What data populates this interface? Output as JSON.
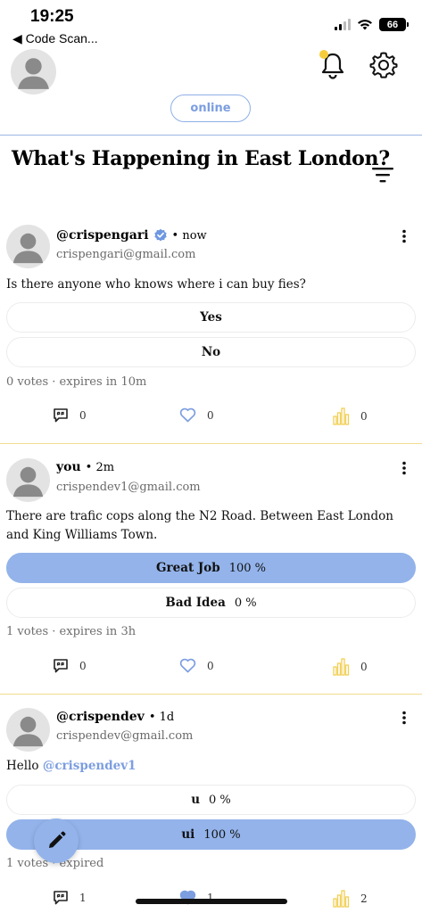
{
  "status_bar": {
    "time": "19:25",
    "back_app": "◀ Code Scan...",
    "battery": "66"
  },
  "header": {
    "online_label": "online",
    "accent_color": "#93b3ea",
    "notification_dot_color": "#f5cd3c"
  },
  "page": {
    "title": "What's Happening in East London?"
  },
  "posts": [
    {
      "username": "@crispengari",
      "verified": true,
      "time_ago": "• now",
      "email": "crispengari@gmail.com",
      "question": "Is there anyone who knows where i can buy fies?",
      "options": [
        {
          "label": "Yes",
          "percent": "",
          "selected": false
        },
        {
          "label": "No",
          "percent": "",
          "selected": false
        }
      ],
      "meta": "0 votes · expires in 10m",
      "comments": "0",
      "likes": "0",
      "stats": "0"
    },
    {
      "username": "you",
      "verified": false,
      "time_ago": "• 2m",
      "email": "crispendev1@gmail.com",
      "question": "There are trafic cops along the N2 Road. Between East London and King Williams Town.",
      "options": [
        {
          "label": "Great Job",
          "percent": "100 %",
          "selected": true
        },
        {
          "label": "Bad Idea",
          "percent": "0 %",
          "selected": false
        }
      ],
      "meta": "1 votes · expires in 3h",
      "comments": "0",
      "likes": "0",
      "stats": "0"
    },
    {
      "username": "@crispendev",
      "verified": false,
      "time_ago": "• 1d",
      "email": "crispendev@gmail.com",
      "question_prefix": "Hello ",
      "question_mention": "@crispendev1",
      "options": [
        {
          "label": "u",
          "percent": "0 %",
          "selected": false
        },
        {
          "label": "ui",
          "percent": "100 %",
          "selected": true
        }
      ],
      "meta": "1 votes · expired",
      "comments": "1",
      "likes": "1",
      "stats": "2"
    }
  ],
  "icons": [
    "avatar",
    "bell-icon",
    "gear-icon",
    "filter-icon",
    "verified-icon",
    "more-icon",
    "comment-icon",
    "heart-icon",
    "stats-icon",
    "pencil-icon"
  ]
}
